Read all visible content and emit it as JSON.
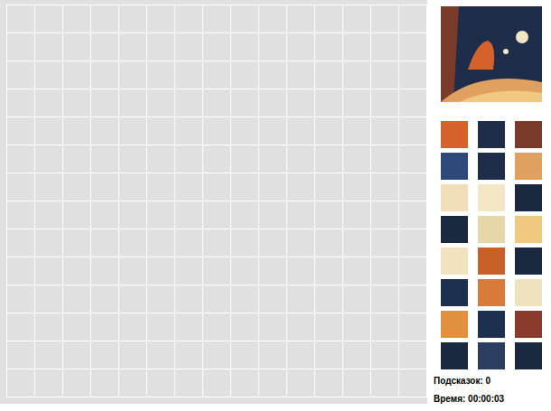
{
  "preview": {
    "kind": "picture"
  },
  "pieces": [
    {
      "color": "#d4622a"
    },
    {
      "color": "#1e2d4a"
    },
    {
      "color": "#7a3a2a"
    },
    {
      "color": "#2e4a7a"
    },
    {
      "color": "#1e2d4a"
    },
    {
      "color": "#e0a060"
    },
    {
      "color": "#f0dfb8"
    },
    {
      "color": "#f2e6c4"
    },
    {
      "color": "#1a2840"
    },
    {
      "color": "#1a2840"
    },
    {
      "color": "#e8d6a8"
    },
    {
      "color": "#f0c880"
    },
    {
      "color": "#f2e2be"
    },
    {
      "color": "#c8602a"
    },
    {
      "color": "#1a2840"
    },
    {
      "color": "#1e3050"
    },
    {
      "color": "#d87a3a"
    },
    {
      "color": "#f0e2bc"
    },
    {
      "color": "#e09040"
    },
    {
      "color": "#1e3050"
    },
    {
      "color": "#8a3a2a"
    },
    {
      "color": "#1a2840"
    },
    {
      "color": "#2a3e60"
    },
    {
      "color": "#1a2840"
    }
  ],
  "status": {
    "hints": "Подсказок: 0",
    "time": "Время: 00:00:03"
  }
}
